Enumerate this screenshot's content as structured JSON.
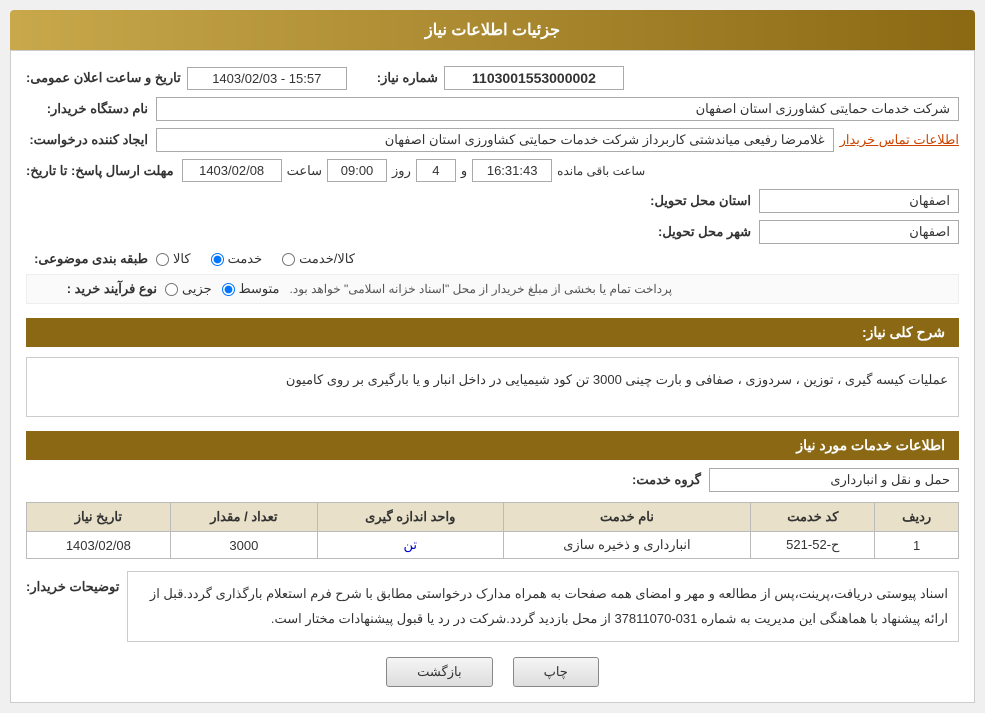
{
  "header": {
    "title": "جزئیات اطلاعات نیاز"
  },
  "fields": {
    "shomare_niaz_label": "شماره نیاز:",
    "shomare_niaz_value": "1103001553000002",
    "name_dasgah_label": "نام دستگاه خریدار:",
    "name_dasgah_value": "شرکت خدمات حمایتی کشاورزی استان اصفهان",
    "tarikh_label": "تاریخ و ساعت اعلان عمومی:",
    "tarikh_value": "1403/02/03 - 15:57",
    "ijad_label": "ایجاد کننده درخواست:",
    "ijad_value": "غلامرضا  رفیعی میاندشتی کاربرداز شرکت خدمات حمایتی کشاورزی استان اصفهان",
    "ijad_link": "اطلاعات تماس خریدار",
    "mohlat_label": "مهلت ارسال پاسخ: تا تاریخ:",
    "mohlat_date": "1403/02/08",
    "mohlat_saaat": "09:00",
    "mohlat_roz": "4",
    "mohlat_saaat_mande": "16:31:43",
    "ostan_label": "استان محل تحویل:",
    "ostan_value": "اصفهان",
    "shahr_label": "شهر محل تحویل:",
    "shahr_value": "اصفهان",
    "tabaqe_label": "طبقه بندی موضوعی:",
    "radio_kala": "کالا",
    "radio_khedmat": "خدمت",
    "radio_kala_khedmat": "کالا/خدمت",
    "radio_selected": "khedmat",
    "nooe_farayand_label": "نوع فرآیند خرید :",
    "radio_jozvi": "جزیی",
    "radio_motevaset": "متوسط",
    "farayand_note": "پرداخت تمام یا بخشی از مبلغ خریدار از محل \"اسناد خزانه اسلامی\" خواهد بود.",
    "sharch_label": "شرح کلی نیاز:",
    "sharch_value": "عملیات کیسه گیری ، توزین ، سردوزی ، صفافی و بارت چینی 3000 تن کود شیمیایی در داخل انبار و یا بارگیری بر روی کامیون",
    "service_info_header": "اطلاعات خدمات مورد نیاز",
    "group_khedmat_label": "گروه خدمت:",
    "group_khedmat_value": "حمل و نقل و انبارداری",
    "table": {
      "headers": [
        "ردیف",
        "کد خدمت",
        "نام خدمت",
        "واحد اندازه گیری",
        "تعداد / مقدار",
        "تاریخ نیاز"
      ],
      "rows": [
        {
          "radif": "1",
          "kod": "ح-52-521",
          "name": "انبارداری و ذخیره سازی",
          "vahed": "تن",
          "tedad": "3000",
          "tarikh": "1403/02/08"
        }
      ]
    },
    "tawzih_label": "توضیحات خریدار:",
    "tawzih_value": "اسناد پیوستی دریافت،پرینت،پس از مطالعه و مهر و امضای همه صفحات به همراه مدارک درخواستی مطابق با شرح فرم استعلام بارگذاری گردد.قبل از ارائه پیشنهاد با هماهنگی این مدیریت به شماره 031-37811070 از محل بازدید گردد.شرکت در رد یا قبول پیشنهادات مختار است.",
    "btn_back": "بازگشت",
    "btn_print": "چاپ"
  }
}
